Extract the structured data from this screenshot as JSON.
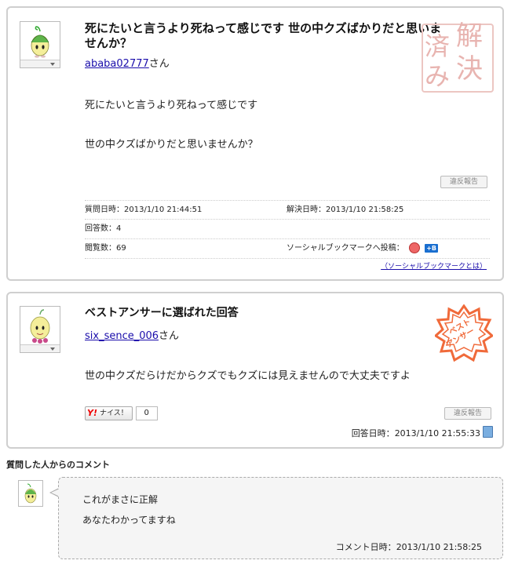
{
  "question": {
    "title_line1": "死にたいと言うより死ねって感じです 世の中クズばかりだと思いま",
    "title_line2": "せんか？",
    "user_link": "ababa02777",
    "user_suffix": "さん",
    "body_line1": "死にたいと言うより死ねって感じです",
    "body_line2": "世の中クズばかりだと思いませんか？",
    "report_label": "違反報告",
    "asked_label": "質問日時：",
    "asked_value": "2013/1/10 21:44:51",
    "resolved_label": "解決日時：",
    "resolved_value": "2013/1/10 21:58:25",
    "answers_label": "回答数：",
    "answers_value": "4",
    "views_label": "閲覧数：",
    "views_value": "69",
    "social_label": "ソーシャルブックマークへ投稿：",
    "social_b": "B",
    "social_help": "（ソーシャルブックマークとは）",
    "stamp": {
      "c1": "解",
      "c2": "決",
      "c3": "済",
      "c4": "み"
    }
  },
  "answer": {
    "heading": "ベストアンサーに選ばれた回答",
    "user_link": "six_sence_006",
    "user_suffix": "さん",
    "body": "世の中クズだらけだからクズでもクズには見えませんので大丈夫ですよ",
    "nice_y": "Y!",
    "nice_label": "ナイス！",
    "nice_count": "0",
    "report_label": "違反報告",
    "answered_label": "回答日時：",
    "answered_value": "2013/1/10 21:55:33",
    "stamp_line1": "ベスト",
    "stamp_line2": "アンサー"
  },
  "comment": {
    "section_title": "質問した人からのコメント",
    "line1": "これがまさに正解",
    "line2": "あなたわかってますね",
    "time_label": "コメント日時：",
    "time_value": "2013/1/10 21:58:25"
  },
  "colors": {
    "stamp_resolved": "#e8b4b0",
    "stamp_best": "#f06a3a",
    "link": "#1a0dab"
  }
}
